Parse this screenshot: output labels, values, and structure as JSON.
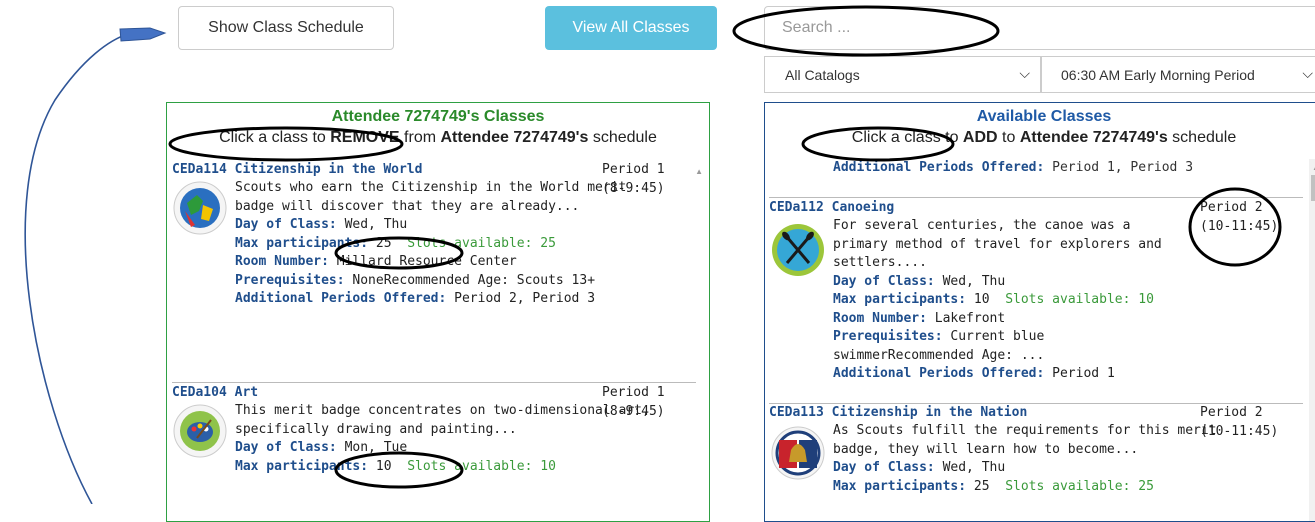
{
  "top": {
    "show_schedule_label": "Show Class Schedule",
    "view_all_label": "View All Classes",
    "search_placeholder": "Search ...",
    "catalog_select": "All Catalogs",
    "period_select": "06:30 AM Early Morning Period"
  },
  "left_panel": {
    "title": "Attendee 7274749's Classes",
    "instruction_pre": "Click a class to ",
    "instruction_action": "REMOVE",
    "instruction_mid": " from ",
    "instruction_name": "Attendee 7274749's",
    "instruction_post": " schedule",
    "items": [
      {
        "code": "CEDa114",
        "name": "Citizenship in the World",
        "desc": "Scouts who earn the Citizenship in the World merit badge will discover that they are already...",
        "day_label": "Day of Class:",
        "day": "Wed, Thu",
        "max_label": "Max participants:",
        "max": "25",
        "slots_label": "Slots available:",
        "slots": "25",
        "room_label": "Room Number:",
        "room": "Millard Resource Center",
        "prereq_label": "Prerequisites:",
        "prereq": "NoneRecommended Age: Scouts 13+",
        "add_label": "Additional Periods Offered:",
        "add": "Period 2, Period 3",
        "period": "Period 1",
        "time": "(8-9:45)"
      },
      {
        "code": "CEDa104",
        "name": "Art",
        "desc": "This merit badge concentrates on two-dimensional art, specifically drawing and painting...",
        "day_label": "Day of Class:",
        "day": "Mon, Tue",
        "max_label": "Max participants:",
        "max": "10",
        "slots_label": "Slots available:",
        "slots": "10",
        "period": "Period 1",
        "time": "(8-9:45)"
      }
    ]
  },
  "right_panel": {
    "title": "Available Classes",
    "instruction_pre": "Click a class to ",
    "instruction_action": "ADD",
    "instruction_mid": " to ",
    "instruction_name": "Attendee 7274749's",
    "instruction_post": " schedule",
    "partial": {
      "add_label": "Additional Periods Offered:",
      "add": "Period 1, Period 3"
    },
    "items": [
      {
        "code": "CEDa112",
        "name": "Canoeing",
        "desc": "For several centuries, the canoe was a primary method of travel for explorers and settlers....",
        "day_label": "Day of Class:",
        "day": "Wed, Thu",
        "max_label": "Max participants:",
        "max": "10",
        "slots_label": "Slots available:",
        "slots": "10",
        "room_label": "Room Number:",
        "room": "Lakefront",
        "prereq_label": "Prerequisites:",
        "prereq": "Current blue swimmerRecommended Age: ...",
        "add_label": "Additional Periods Offered:",
        "add": "Period 1",
        "period": "Period 2",
        "time": "(10-11:45)"
      },
      {
        "code": "CEDa113",
        "name": "Citizenship in the Nation",
        "desc": "As Scouts fulfill the requirements for this merit badge, they will learn how to become...",
        "day_label": "Day of Class:",
        "day": "Wed, Thu",
        "max_label": "Max participants:",
        "max": "25",
        "slots_label": "Slots available:",
        "slots": "25",
        "period": "Period 2",
        "time": "(10-11:45)"
      }
    ]
  },
  "colors": {
    "annotation": "#000000",
    "arrow": "#4472c4",
    "green": "#2ea043",
    "blue": "#1f4e8c",
    "info": "#5bc0de"
  }
}
